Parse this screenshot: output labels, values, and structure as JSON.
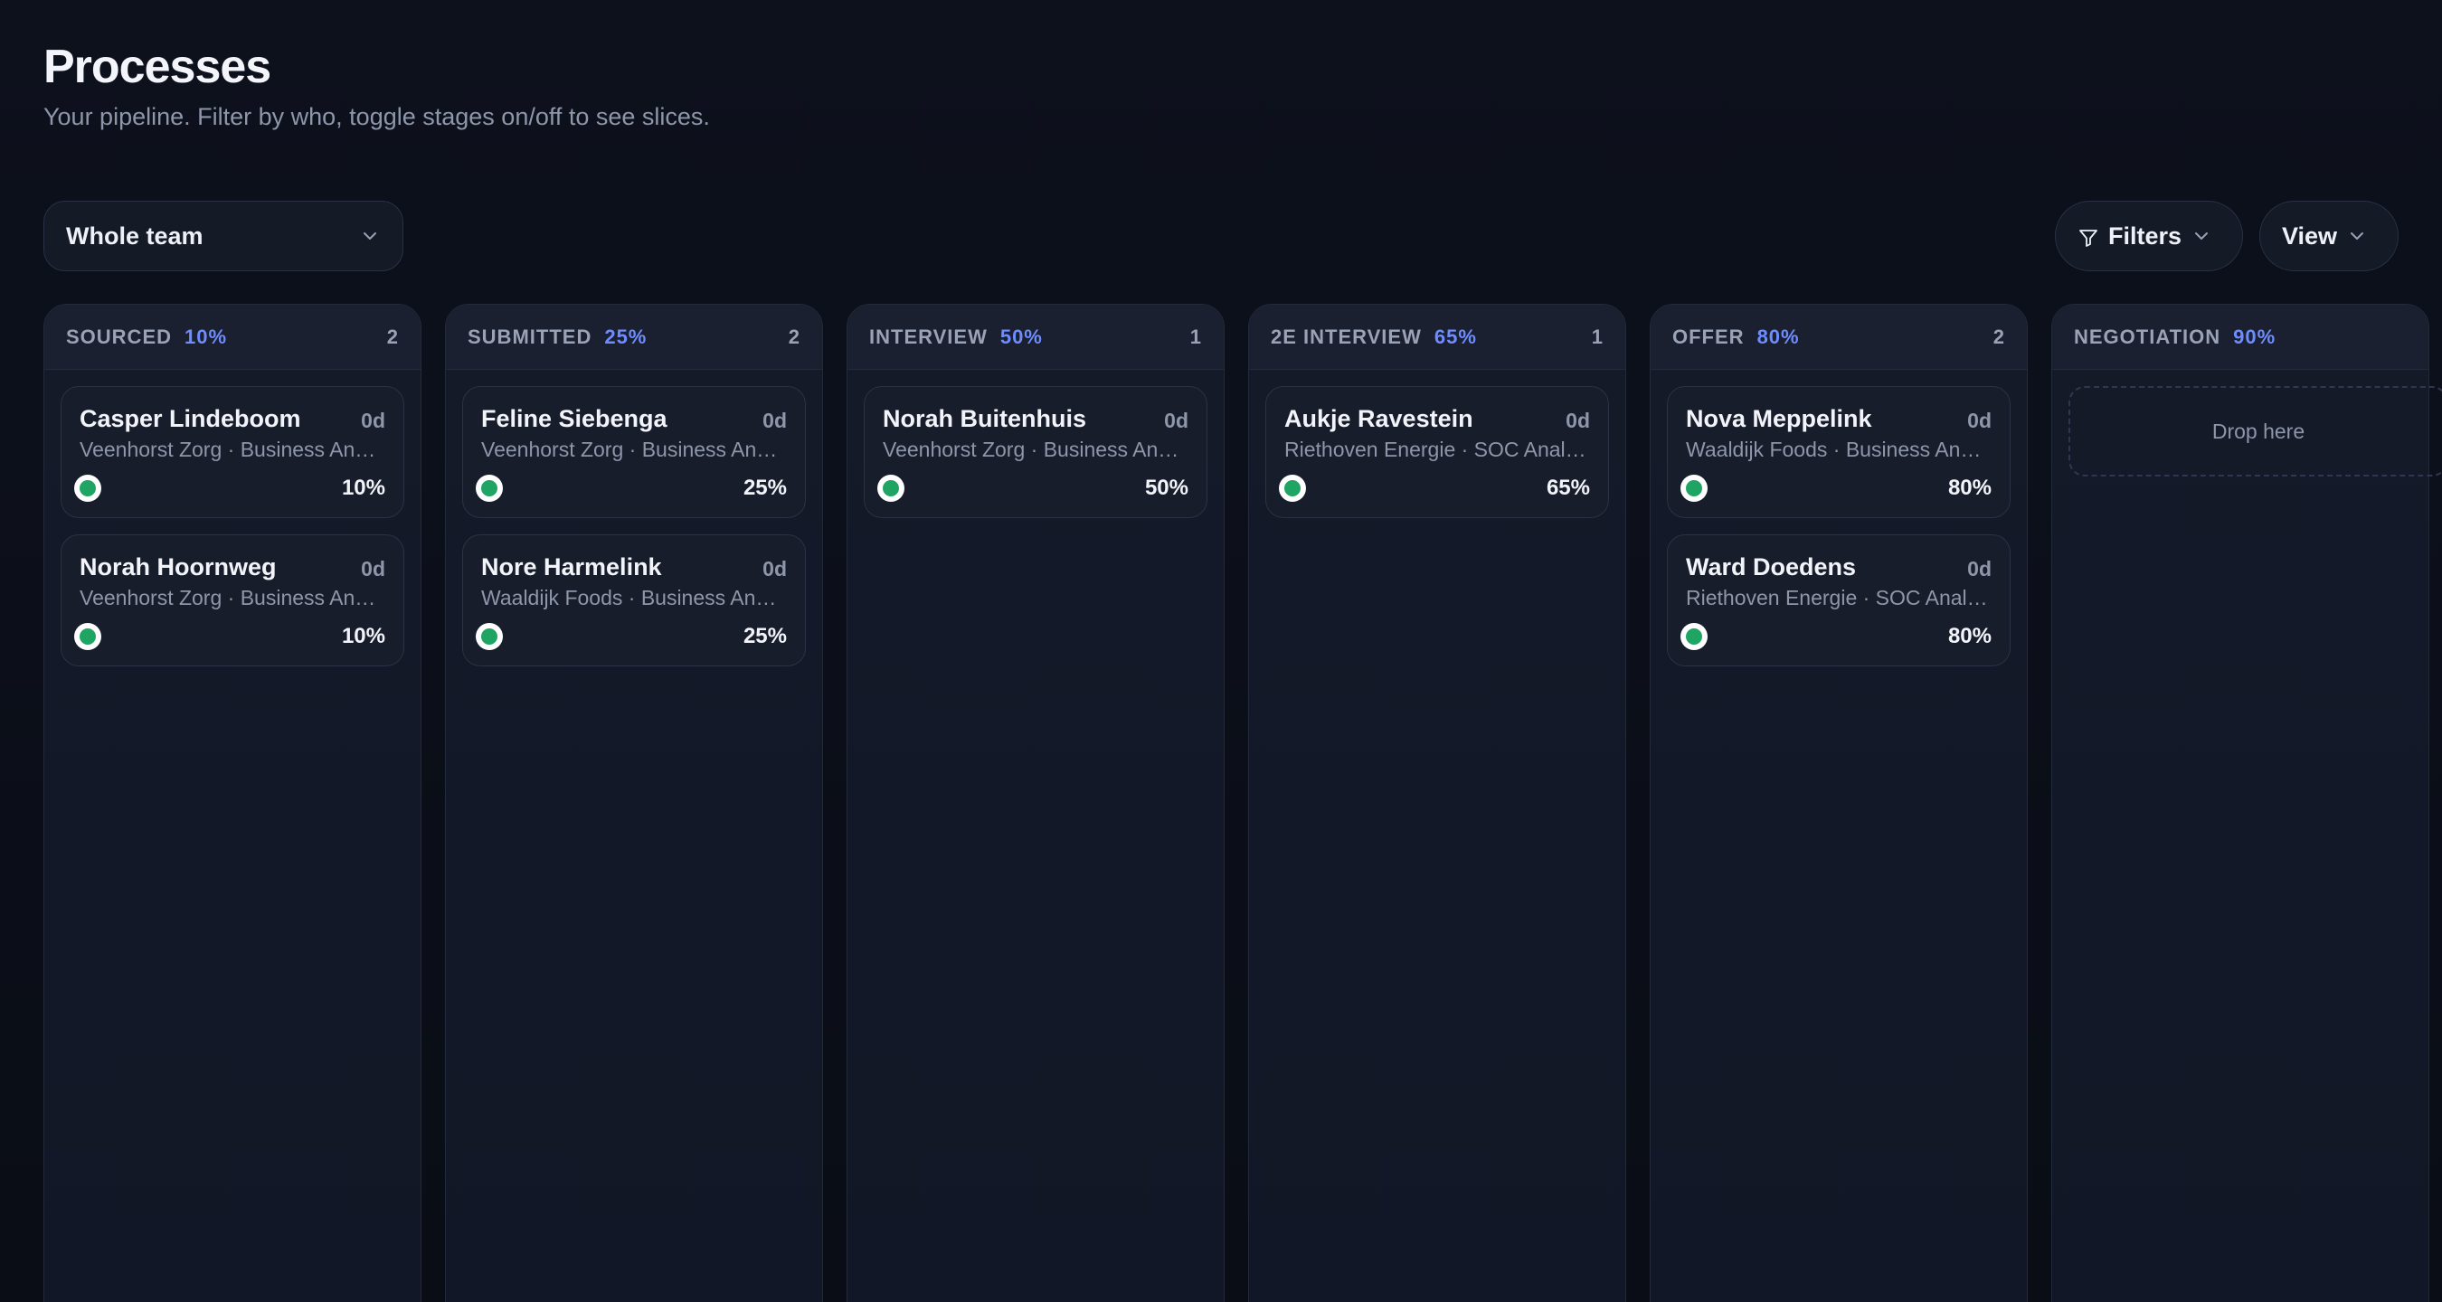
{
  "page": {
    "title": "Processes",
    "subtitle": "Your pipeline. Filter by who, toggle stages on/off to see slices."
  },
  "toolbar": {
    "team_select": "Whole team",
    "filters_label": "Filters",
    "view_label": "View"
  },
  "icons": {
    "chevron": "chevron-down-icon",
    "filter": "funnel-icon",
    "status": "status-dot-icon"
  },
  "colors": {
    "accent": "#6f8cff",
    "status_green": "#1fa463",
    "background": "#0b0e17"
  },
  "columns": [
    {
      "name": "SOURCED",
      "pct": "10%",
      "count": "2",
      "cards": [
        {
          "name": "Casper Lindeboom",
          "age": "0d",
          "meta": "Veenhorst Zorg · Business Analyst",
          "pct": "10%"
        },
        {
          "name": "Norah Hoornweg",
          "age": "0d",
          "meta": "Veenhorst Zorg · Business Analyst",
          "pct": "10%"
        }
      ]
    },
    {
      "name": "SUBMITTED",
      "pct": "25%",
      "count": "2",
      "cards": [
        {
          "name": "Feline Siebenga",
          "age": "0d",
          "meta": "Veenhorst Zorg · Business Analyst",
          "pct": "25%"
        },
        {
          "name": "Nore Harmelink",
          "age": "0d",
          "meta": "Waaldijk Foods · Business Analyst",
          "pct": "25%"
        }
      ]
    },
    {
      "name": "INTERVIEW",
      "pct": "50%",
      "count": "1",
      "cards": [
        {
          "name": "Norah Buitenhuis",
          "age": "0d",
          "meta": "Veenhorst Zorg · Business Analyst",
          "pct": "50%"
        }
      ]
    },
    {
      "name": "2E INTERVIEW",
      "pct": "65%",
      "count": "1",
      "cards": [
        {
          "name": "Aukje Ravestein",
          "age": "0d",
          "meta": "Riethoven Energie · SOC Analyst",
          "pct": "65%"
        }
      ]
    },
    {
      "name": "OFFER",
      "pct": "80%",
      "count": "2",
      "cards": [
        {
          "name": "Nova Meppelink",
          "age": "0d",
          "meta": "Waaldijk Foods · Business Analyst",
          "pct": "80%"
        },
        {
          "name": "Ward Doedens",
          "age": "0d",
          "meta": "Riethoven Energie · SOC Analyst",
          "pct": "80%"
        }
      ]
    },
    {
      "name": "NEGOTIATION",
      "pct": "90%",
      "count": "",
      "drop_label": "Drop here",
      "cards": []
    }
  ]
}
